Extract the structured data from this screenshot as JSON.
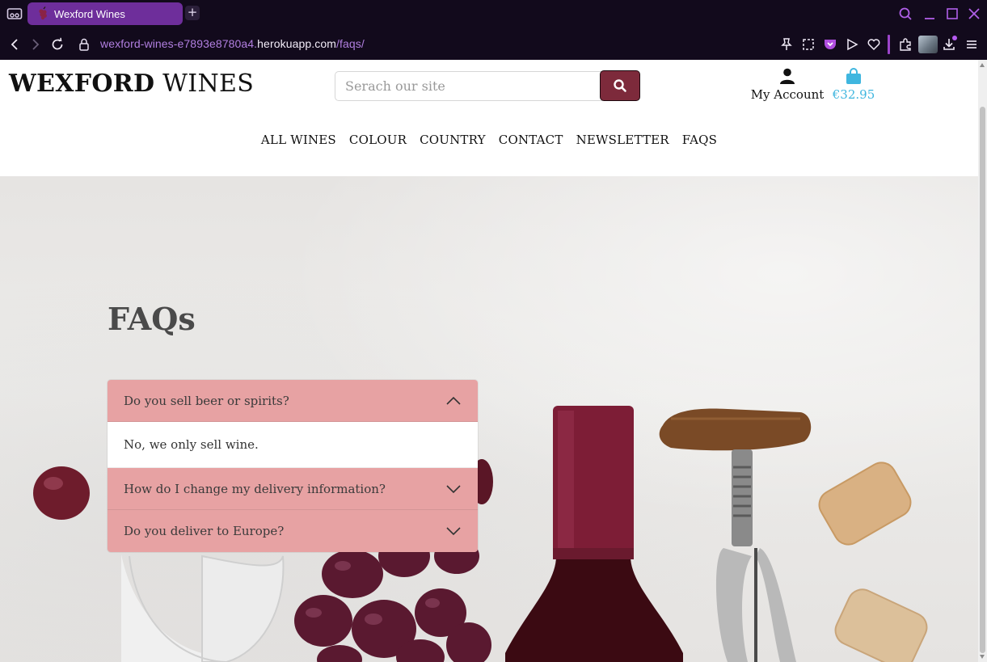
{
  "browser": {
    "tab_title": "Wexford Wines",
    "new_tab_label": "+",
    "url_prefix": "wexford-wines-e7893e8780a4.",
    "url_domain": "herokuapp.com",
    "url_path": "/faqs/",
    "accent_color": "#9b44c9"
  },
  "header": {
    "logo_bold": "WEXFORD",
    "logo_rest": " WINES",
    "search_placeholder": "Serach our site",
    "account_label": "My Account",
    "bag_total": "€32.95",
    "bag_color": "#3fb6df",
    "search_button_color": "#7d2a3b"
  },
  "nav": {
    "items": [
      "ALL WINES",
      "COLOUR",
      "COUNTRY",
      "CONTACT",
      "NEWSLETTER",
      "FAQS"
    ]
  },
  "faq": {
    "title": "FAQs",
    "accent_color": "#e7a2a3",
    "items": [
      {
        "question": "Do you sell beer or spirits?",
        "answer": "No, we only sell wine.",
        "expanded": true
      },
      {
        "question": "How do I change my delivery information?",
        "expanded": false
      },
      {
        "question": "Do you deliver to Europe?",
        "expanded": false
      }
    ]
  }
}
